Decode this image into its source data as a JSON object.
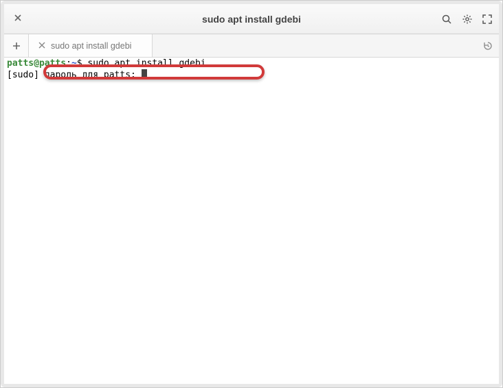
{
  "titlebar": {
    "title": "sudo apt install gdebi"
  },
  "tabs": {
    "items": [
      {
        "label": "sudo apt install gdebi"
      }
    ]
  },
  "terminal": {
    "line1": {
      "user": "patts",
      "at": "@",
      "host": "patts",
      "colon": ":",
      "path": "~",
      "sep": "$ ",
      "command": "sudo apt install gdebi"
    },
    "line2": {
      "prefix": "[sudo] ",
      "text": "пароль для patts: "
    }
  }
}
